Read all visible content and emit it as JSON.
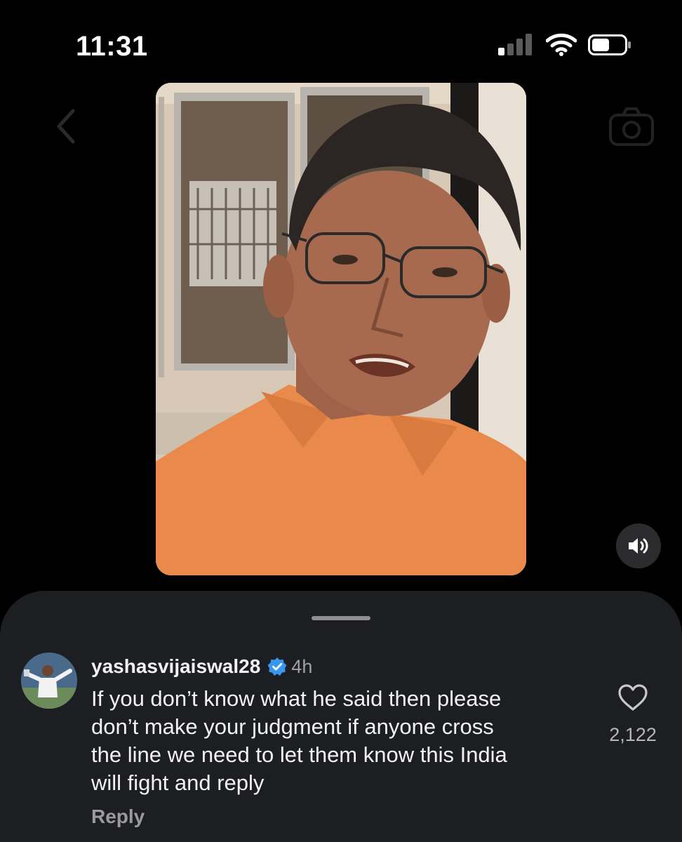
{
  "status_bar": {
    "time": "11:31",
    "signal_bars_active": 1,
    "signal_bars_total": 4
  },
  "video": {
    "controls": {
      "sound_icon": "speaker-icon"
    }
  },
  "nav": {
    "back_icon": "chevron-left-icon",
    "camera_icon": "camera-icon"
  },
  "comments": {
    "items": [
      {
        "username": "yashasvijaiswal28",
        "verified": true,
        "time": "4h",
        "text": "If you don’t know what he said then please\ndon’t make your judgment if  anyone cross\nthe line we need to let them know this India\nwill fight and reply",
        "reply_label": "Reply",
        "like_count": "2,122",
        "like_icon": "heart-icon"
      }
    ]
  },
  "colors": {
    "background": "#000000",
    "sheet": "#1c1e22",
    "verified": "#3897f0",
    "shirt": "#e98a4c"
  }
}
